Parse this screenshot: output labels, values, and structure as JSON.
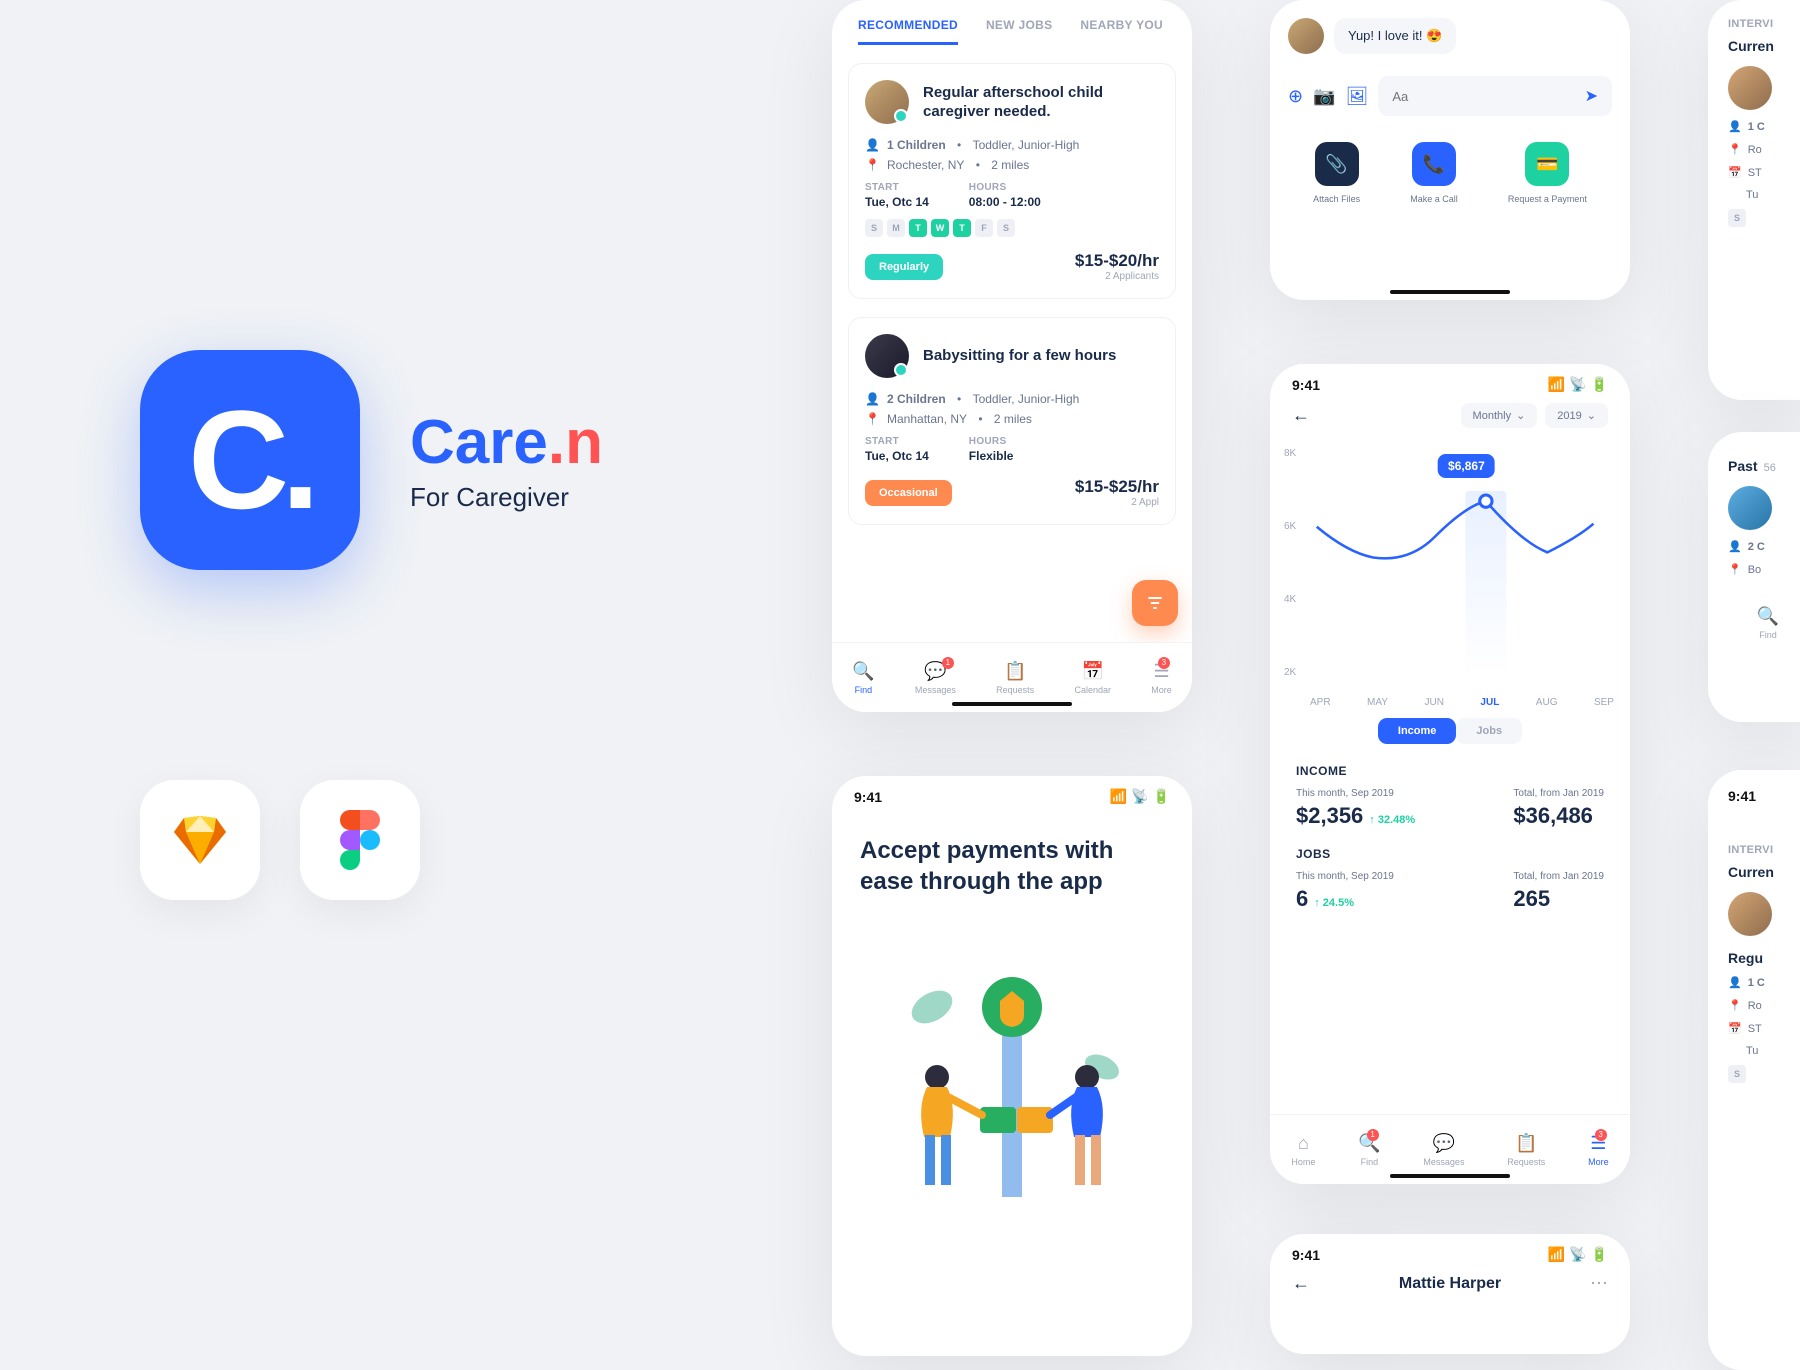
{
  "brand": {
    "name_main": "Care",
    "name_suffix": ".n",
    "subtitle": "For Caregiver"
  },
  "tools": {
    "sketch": "sketch-icon",
    "figma": "figma-icon"
  },
  "status": {
    "time": "9:41"
  },
  "jobs": {
    "tabs": [
      "RECOMMENDED",
      "NEW JOBS",
      "NEARBY YOU"
    ],
    "active_tab": 0,
    "cards": [
      {
        "title": "Regular afterschool child caregiver needed.",
        "children": "1 Children",
        "ages": "Toddler, Junior-High",
        "location": "Rochester, NY",
        "distance": "2 miles",
        "start_label": "START",
        "start_value": "Tue, Otc 14",
        "hours_label": "HOURS",
        "hours_value": "08:00 - 12:00",
        "days": [
          "S",
          "M",
          "T",
          "W",
          "T",
          "F",
          "S"
        ],
        "days_on": [
          false,
          false,
          true,
          true,
          true,
          false,
          false
        ],
        "badge": "Regularly",
        "badge_type": "reg",
        "price": "$15-$20/hr",
        "applicants": "2 Applicants"
      },
      {
        "title": "Babysitting for a few hours",
        "children": "2 Children",
        "ages": "Toddler, Junior-High",
        "location": "Manhattan, NY",
        "distance": "2 miles",
        "start_label": "START",
        "start_value": "Tue, Otc 14",
        "hours_label": "HOURS",
        "hours_value": "Flexible",
        "badge": "Occasional",
        "badge_type": "occ",
        "price": "$15-$25/hr",
        "applicants": "2 Appl"
      }
    ],
    "nav": [
      {
        "label": "Find",
        "active": true
      },
      {
        "label": "Messages",
        "badge": "1"
      },
      {
        "label": "Requests"
      },
      {
        "label": "Calendar"
      },
      {
        "label": "More",
        "badge": "3"
      }
    ]
  },
  "chat": {
    "message": "Yup! I love it! 😍",
    "placeholder": "Aa",
    "actions": [
      {
        "label": "Attach\nFiles",
        "type": "attach"
      },
      {
        "label": "Make\na Call",
        "type": "call"
      },
      {
        "label": "Request a\nPayment",
        "type": "pay"
      }
    ]
  },
  "analytics": {
    "period_sel": "Monthly",
    "year_sel": "2019",
    "tooltip": "$6,867",
    "y_ticks": [
      "8K",
      "6K",
      "4K",
      "2K"
    ],
    "x_ticks": [
      "APR",
      "MAY",
      "JUN",
      "JUL",
      "AUG",
      "SEP"
    ],
    "x_active": 3,
    "seg": [
      "Income",
      "Jobs"
    ],
    "seg_active": 0,
    "income": {
      "heading": "INCOME",
      "month_label": "This month, Sep 2019",
      "month_value": "$2,356",
      "month_delta": "↑ 32.48%",
      "total_label": "Total, from Jan 2019",
      "total_value": "$36,486"
    },
    "jobs_stat": {
      "heading": "JOBS",
      "month_label": "This month, Sep 2019",
      "month_value": "6",
      "month_delta": "↑ 24.5%",
      "total_label": "Total, from Jan 2019",
      "total_value": "265"
    },
    "nav": [
      {
        "label": "Home"
      },
      {
        "label": "Find",
        "badge": "1"
      },
      {
        "label": "Messages"
      },
      {
        "label": "Requests"
      },
      {
        "label": "More",
        "active": true,
        "badge": "3"
      }
    ]
  },
  "onboarding": {
    "title": "Accept payments with ease through the app"
  },
  "msg_detail": {
    "name": "Mattie Harper"
  },
  "partials": {
    "section1": "INTERVI",
    "current": "Curren",
    "past": "Past",
    "past_count": "56",
    "row1": "1 C",
    "row_loc": "Ro",
    "row_st": "ST",
    "row_date": "Tu",
    "row2_c": "2 C",
    "row2_loc": "Bo",
    "find": "Find",
    "regu": "Regu"
  },
  "chart_data": {
    "type": "line",
    "title": "",
    "xlabel": "",
    "ylabel": "",
    "ylim": [
      0,
      8000
    ],
    "categories": [
      "APR",
      "MAY",
      "JUN",
      "JUL",
      "AUG",
      "SEP"
    ],
    "series": [
      {
        "name": "Income",
        "values": [
          5800,
          4800,
          5600,
          6867,
          5400,
          5900
        ]
      }
    ],
    "highlight": {
      "index": 3,
      "value": 6867,
      "label": "$6,867"
    }
  }
}
